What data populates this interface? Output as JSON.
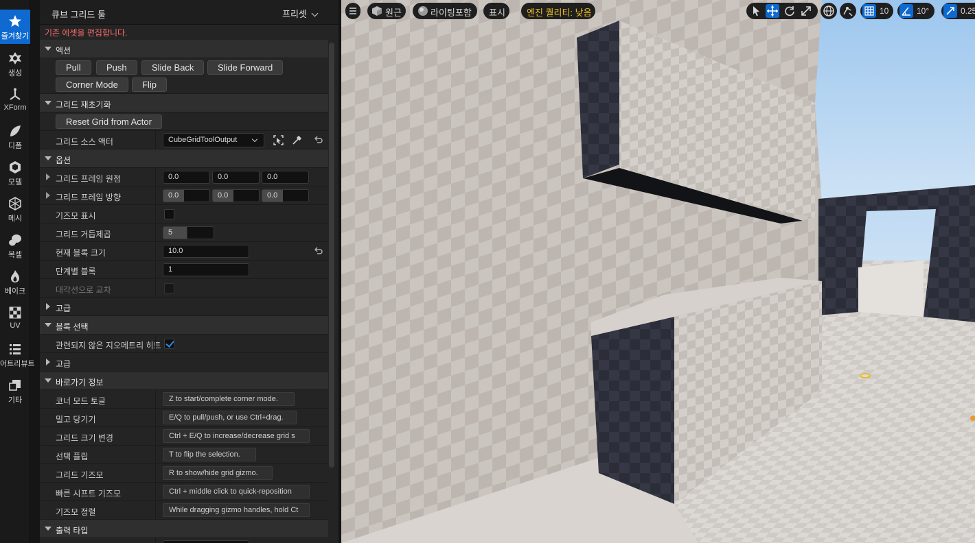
{
  "modebar": {
    "items": [
      {
        "label": "즐겨찾기",
        "icon": "star-icon"
      },
      {
        "label": "생성",
        "icon": "create-icon"
      },
      {
        "label": "XForm",
        "icon": "xform-icon"
      },
      {
        "label": "디폼",
        "icon": "deform-icon"
      },
      {
        "label": "모델",
        "icon": "model-icon"
      },
      {
        "label": "메시",
        "icon": "mesh-icon"
      },
      {
        "label": "복셀",
        "icon": "voxel-icon"
      },
      {
        "label": "베이크",
        "icon": "bake-icon"
      },
      {
        "label": "UV",
        "icon": "uv-icon"
      },
      {
        "label": "어트리뷰트",
        "icon": "attributes-icon"
      },
      {
        "label": "기타",
        "icon": "misc-icon"
      }
    ]
  },
  "panel": {
    "title": "큐브 그리드 툴",
    "preset_label": "프리셋",
    "warning": "기존 에셋을 편집합니다.",
    "sections": {
      "actions": "액션",
      "reinit": "그리드 재초기화",
      "options": "옵션",
      "advanced": "고급",
      "block_selection": "블록 선택",
      "advanced2": "고급",
      "shortcuts": "바로가기 정보",
      "output_type": "출력 타입"
    },
    "actions": {
      "pull": "Pull",
      "push": "Push",
      "slide_back": "Slide Back",
      "slide_forward": "Slide Forward",
      "corner_mode": "Corner Mode",
      "flip": "Flip"
    },
    "reinit": {
      "reset_button": "Reset Grid from Actor",
      "source_actor_label": "그리드 소스 액터",
      "source_actor_value": "CubeGridToolOutput"
    },
    "options": {
      "frame_origin_label": "그리드 프레임 원점",
      "frame_origin": [
        "0.0",
        "0.0",
        "0.0"
      ],
      "frame_orientation_label": "그리드 프레임 방향",
      "frame_orientation": [
        "0.0",
        "0.0",
        "0.0"
      ],
      "show_gizmo_label": "기즈모 표시",
      "show_gizmo": false,
      "power_label": "그리드 거듭제곱",
      "power_value": "5",
      "block_size_label": "현재 블록 크기",
      "block_size_value": "10.0",
      "blocks_per_step_label": "단계별 블록",
      "blocks_per_step_value": "1",
      "diagonal_label": "대각선으로 교차",
      "diagonal": false
    },
    "block_selection": {
      "hit_unrelated_label": "관련되지 않은 지오메트리 히트",
      "hit_unrelated": true
    },
    "shortcuts": [
      {
        "label": "코너 모드 토글",
        "value": "Z to start/complete corner mode."
      },
      {
        "label": "밀고 당기기",
        "value": "E/Q to pull/push, or use Ctrl+drag."
      },
      {
        "label": "그리드 크기 변경",
        "value": "Ctrl + E/Q to increase/decrease grid s"
      },
      {
        "label": "선택 플립",
        "value": "T to flip the selection."
      },
      {
        "label": "그리드 기즈모",
        "value": "R to show/hide grid gizmo."
      },
      {
        "label": "빠른 시프트 기즈모",
        "value": "Ctrl + middle click to quick-reposition"
      },
      {
        "label": "기즈모 정렬",
        "value": "While dragging gizmo handles, hold Ct"
      }
    ]
  },
  "viewport": {
    "menu_icon": "hamburger-menu-icon",
    "perspective_label": "원근",
    "lighting_label": "라이팅포함",
    "show_label": "표시",
    "quality_label": "엔진 퀄리티: 낮음",
    "grid_snap_value": "10",
    "rotation_snap_value": "10°",
    "scale_snap_value": "0.25",
    "colors": {
      "accent": "#0e6ad0",
      "warning": "#f0c020",
      "error": "#ff6a6a"
    }
  }
}
